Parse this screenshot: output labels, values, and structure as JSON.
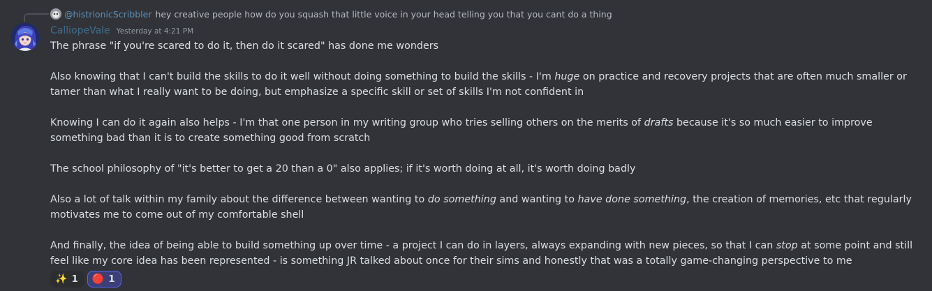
{
  "reply": {
    "username": "@histrionicScribbler",
    "text": "hey creative people how do you squash that little voice in your head telling you that you cant do a thing"
  },
  "message": {
    "username": "CalliopeVale",
    "timestamp": "Yesterday at 4:21 PM",
    "paragraphs": [
      [
        {
          "text": "The phrase \"if you're scared to do it, then do it scared\" has done me wonders"
        }
      ],
      [
        {
          "text": "Also knowing that I can't build the skills to do it well without doing something to build the skills - I'm "
        },
        {
          "text": "huge",
          "em": true
        },
        {
          "text": " on practice and recovery projects that are often much smaller or tamer than what I really want to be doing, but emphasize a specific skill or set of skills I'm not confident in"
        }
      ],
      [
        {
          "text": "Knowing I can do it again also helps - I'm that one person in my writing group who tries selling others on the merits of "
        },
        {
          "text": "drafts",
          "em": true
        },
        {
          "text": " because it's so much easier to improve something bad than it is to create something good from scratch"
        }
      ],
      [
        {
          "text": "The school philosophy of \"it's better to get a 20 than a 0\" also applies; if it's worth doing at all, it's worth doing badly"
        }
      ],
      [
        {
          "text": "Also a lot of talk within my family about the difference between wanting to "
        },
        {
          "text": "do something",
          "em": true
        },
        {
          "text": " and wanting to "
        },
        {
          "text": "have done something",
          "em": true
        },
        {
          "text": ", the creation of memories, etc that regularly motivates me to come out of my comfortable shell"
        }
      ],
      [
        {
          "text": "And finally, the idea of being able to build something up over time - a project I can do in layers, always expanding with new pieces, so that I can "
        },
        {
          "text": "stop",
          "em": true
        },
        {
          "text": " at some point and still feel like my core idea has been represented - is something JR talked about once for their sims and honestly that was a totally game-changing perspective to me"
        }
      ]
    ]
  },
  "reactions": [
    {
      "emoji": "✨",
      "icon": "sparkles-icon",
      "count": "1",
      "me": false
    },
    {
      "emoji": "🔴",
      "icon": "red-balloon-icon",
      "count": "1",
      "me": true
    }
  ],
  "colors": {
    "background": "#313338",
    "username": "#3e6f8e",
    "reply_username": "#5d8fb7",
    "text": "#dbdee1",
    "muted": "#949ba4",
    "reaction_me_border": "#5865f2"
  }
}
